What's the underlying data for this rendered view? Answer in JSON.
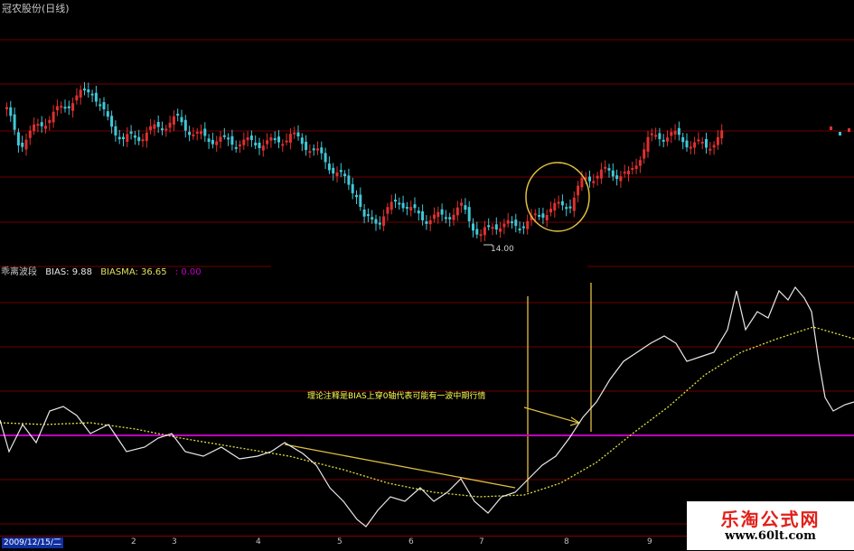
{
  "window": {
    "title": "冠农股份(日线)"
  },
  "indicator": {
    "name": "乖离波段",
    "bias_label": "BIAS: 9.88",
    "biasma_label": "BIASMA: 36.65",
    "zero_label": ": 0.00"
  },
  "annotations": {
    "note": "理论注释是BIAS上穿0轴代表可能有一波中期行情",
    "low_price": "14.00"
  },
  "timeline": {
    "first_date": "2009/12/15/二",
    "ticks": [
      "2",
      "3",
      "4",
      "5",
      "6",
      "7",
      "8",
      "9"
    ]
  },
  "watermark": {
    "cn": "乐淘公式网",
    "url": "www.60lt.com"
  },
  "colors": {
    "up": "#e03030",
    "down": "#40c8d8",
    "bias_line": "#e8e8e8",
    "biasma_line": "#e0e040",
    "zero_axis": "#c000c0",
    "grid": "#700000",
    "marker": "#e0c040"
  }
}
